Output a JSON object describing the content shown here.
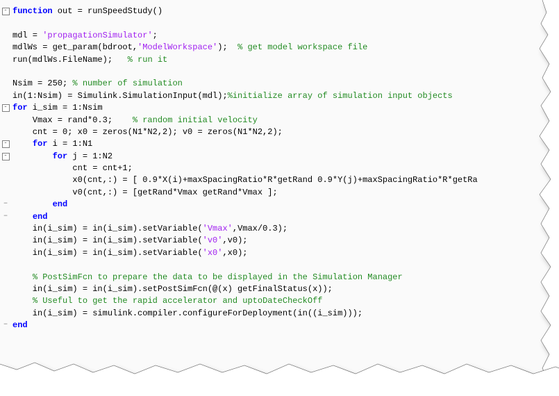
{
  "code": {
    "lines": [
      {
        "gutter": "box",
        "segments": [
          {
            "cls": "kw",
            "t": "function"
          },
          {
            "cls": "id",
            "t": " out = runSpeedStudy()"
          }
        ]
      },
      {
        "gutter": "",
        "segments": []
      },
      {
        "gutter": "",
        "segments": [
          {
            "cls": "id",
            "t": "mdl = "
          },
          {
            "cls": "str",
            "t": "'propagationSimulator'"
          },
          {
            "cls": "id",
            "t": ";"
          }
        ]
      },
      {
        "gutter": "",
        "segments": [
          {
            "cls": "id",
            "t": "mdlWs = get_param(bdroot,"
          },
          {
            "cls": "str",
            "t": "'ModelWorkspace'"
          },
          {
            "cls": "id",
            "t": ");  "
          },
          {
            "cls": "cmt",
            "t": "% get model workspace file"
          }
        ]
      },
      {
        "gutter": "",
        "segments": [
          {
            "cls": "id",
            "t": "run(mdlWs.FileName);   "
          },
          {
            "cls": "cmt",
            "t": "% run it"
          }
        ]
      },
      {
        "gutter": "",
        "segments": []
      },
      {
        "gutter": "",
        "segments": [
          {
            "cls": "id",
            "t": "Nsim = 250; "
          },
          {
            "cls": "cmt",
            "t": "% number of simulation"
          }
        ]
      },
      {
        "gutter": "",
        "segments": [
          {
            "cls": "id",
            "t": "in(1:Nsim) = Simulink.SimulationInput(mdl);"
          },
          {
            "cls": "cmt",
            "t": "%initialize array of simulation input objects"
          }
        ]
      },
      {
        "gutter": "box",
        "segments": [
          {
            "cls": "kw",
            "t": "for"
          },
          {
            "cls": "id",
            "t": " i_sim = 1:Nsim"
          }
        ]
      },
      {
        "gutter": "",
        "segments": [
          {
            "cls": "id",
            "t": "    Vmax = rand*0.3;    "
          },
          {
            "cls": "cmt",
            "t": "% random initial velocity"
          }
        ]
      },
      {
        "gutter": "",
        "segments": [
          {
            "cls": "id",
            "t": "    cnt = 0; x0 = zeros(N1*N2,2); v0 = zeros(N1*N2,2);"
          }
        ]
      },
      {
        "gutter": "box",
        "segments": [
          {
            "cls": "id",
            "t": "    "
          },
          {
            "cls": "kw",
            "t": "for"
          },
          {
            "cls": "id",
            "t": " i = 1:N1"
          }
        ]
      },
      {
        "gutter": "box",
        "segments": [
          {
            "cls": "id",
            "t": "        "
          },
          {
            "cls": "kw",
            "t": "for"
          },
          {
            "cls": "id",
            "t": " j = 1:N2"
          }
        ]
      },
      {
        "gutter": "",
        "segments": [
          {
            "cls": "id",
            "t": "            cnt = cnt+1;"
          }
        ]
      },
      {
        "gutter": "",
        "segments": [
          {
            "cls": "id",
            "t": "            x0(cnt,:) = [ 0.9*X(i)+maxSpacingRatio*R*getRand 0.9*Y(j)+maxSpacingRatio*R*getRa"
          }
        ]
      },
      {
        "gutter": "",
        "segments": [
          {
            "cls": "id",
            "t": "            v0(cnt,:) = [getRand*Vmax getRand*Vmax ];"
          }
        ]
      },
      {
        "gutter": "dash",
        "segments": [
          {
            "cls": "id",
            "t": "        "
          },
          {
            "cls": "kw",
            "t": "end"
          }
        ]
      },
      {
        "gutter": "dash",
        "segments": [
          {
            "cls": "id",
            "t": "    "
          },
          {
            "cls": "kw",
            "t": "end"
          }
        ]
      },
      {
        "gutter": "",
        "segments": [
          {
            "cls": "id",
            "t": "    in(i_sim) = in(i_sim).setVariable("
          },
          {
            "cls": "str",
            "t": "'Vmax'"
          },
          {
            "cls": "id",
            "t": ",Vmax/0.3);"
          }
        ]
      },
      {
        "gutter": "",
        "segments": [
          {
            "cls": "id",
            "t": "    in(i_sim) = in(i_sim).setVariable("
          },
          {
            "cls": "str",
            "t": "'v0'"
          },
          {
            "cls": "id",
            "t": ",v0);"
          }
        ]
      },
      {
        "gutter": "",
        "segments": [
          {
            "cls": "id",
            "t": "    in(i_sim) = in(i_sim).setVariable("
          },
          {
            "cls": "str",
            "t": "'x0'"
          },
          {
            "cls": "id",
            "t": ",x0);"
          }
        ]
      },
      {
        "gutter": "",
        "segments": []
      },
      {
        "gutter": "",
        "segments": [
          {
            "cls": "id",
            "t": "    "
          },
          {
            "cls": "cmt",
            "t": "% PostSimFcn to prepare the data to be displayed in the Simulation Manager"
          }
        ]
      },
      {
        "gutter": "",
        "segments": [
          {
            "cls": "id",
            "t": "    in(i_sim) = in(i_sim).setPostSimFcn(@(x) getFinalStatus(x));"
          }
        ]
      },
      {
        "gutter": "",
        "segments": [
          {
            "cls": "id",
            "t": "    "
          },
          {
            "cls": "cmt",
            "t": "% Useful to get the rapid accelerator and uptoDateCheckOff"
          }
        ]
      },
      {
        "gutter": "",
        "segments": [
          {
            "cls": "id",
            "t": "    in(i_sim) = simulink.compiler.configureForDeployment(in((i_sim)));"
          }
        ]
      },
      {
        "gutter": "dash",
        "segments": [
          {
            "cls": "kw",
            "t": "end"
          }
        ]
      }
    ]
  }
}
